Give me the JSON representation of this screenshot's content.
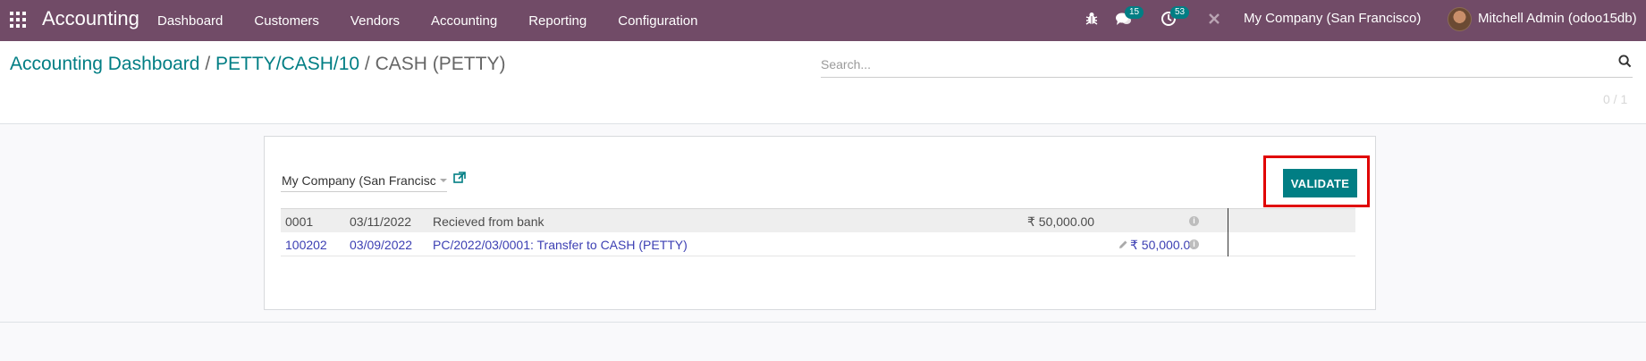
{
  "navbar": {
    "app_title": "Accounting",
    "menu": [
      "Dashboard",
      "Customers",
      "Vendors",
      "Accounting",
      "Reporting",
      "Configuration"
    ],
    "messages_count": "15",
    "activities_count": "53",
    "company": "My Company (San Francisco)",
    "user": "Mitchell Admin (odoo15db)",
    "icons": [
      "apps-grid-icon",
      "bug-icon",
      "chat-icon",
      "clock-icon",
      "tools-icon"
    ]
  },
  "control_panel": {
    "breadcrumb": {
      "item1": "Accounting Dashboard",
      "sep1": "/",
      "item2": "PETTY/CASH/10",
      "sep2": "/",
      "current": "CASH (PETTY)"
    },
    "search_placeholder": "Search...",
    "pager": "0 / 1"
  },
  "reconciliation": {
    "company_value": "My Company (San Francisc",
    "validate_label": "VALIDATE",
    "statement_line": {
      "ref": "0001",
      "date": "03/11/2022",
      "label": "Recieved from bank",
      "amount": "₹ 50,000.00"
    },
    "proposed_line": {
      "account": "100202",
      "date": "03/09/2022",
      "label": "PC/2022/03/0001: Transfer to CASH (PETTY)",
      "amount": "₹ 50,000.00"
    },
    "colors": {
      "brand": "#714b67",
      "accent": "#017e84",
      "link": "#3c3fb3",
      "highlight": "#e00000"
    }
  }
}
